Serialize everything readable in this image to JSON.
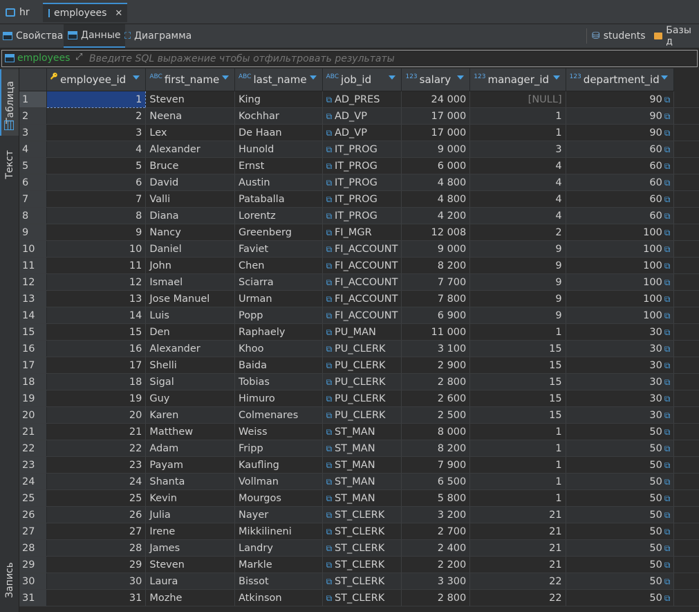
{
  "tabs": [
    {
      "label": "hr",
      "icon": "database-icon"
    },
    {
      "label": "employees",
      "icon": "table-icon",
      "close": "✕"
    }
  ],
  "toolbar": {
    "properties": "Свойства",
    "data": "Данные",
    "diagram": "Диаграмма",
    "students": "students",
    "databases": "Базы д"
  },
  "filter": {
    "table_name": "employees",
    "placeholder": "Введите SQL выражение чтобы отфильтровать результаты"
  },
  "side_tabs": {
    "table": "Таблица",
    "text": "Текст",
    "record": "Запись"
  },
  "columns": [
    "employee_id",
    "first_name",
    "last_name",
    "job_id",
    "salary",
    "manager_id",
    "department_id"
  ],
  "column_types": [
    "",
    "ABC",
    "ABC",
    "ABC",
    "123",
    "123",
    "123"
  ],
  "rows": [
    [
      "1",
      "1",
      "Steven",
      "King",
      "AD_PRES",
      "24 000",
      "[NULL]",
      "90"
    ],
    [
      "2",
      "2",
      "Neena",
      "Kochhar",
      "AD_VP",
      "17 000",
      "1",
      "90"
    ],
    [
      "3",
      "3",
      "Lex",
      "De Haan",
      "AD_VP",
      "17 000",
      "1",
      "90"
    ],
    [
      "4",
      "4",
      "Alexander",
      "Hunold",
      "IT_PROG",
      "9 000",
      "3",
      "60"
    ],
    [
      "5",
      "5",
      "Bruce",
      "Ernst",
      "IT_PROG",
      "6 000",
      "4",
      "60"
    ],
    [
      "6",
      "6",
      "David",
      "Austin",
      "IT_PROG",
      "4 800",
      "4",
      "60"
    ],
    [
      "7",
      "7",
      "Valli",
      "Pataballa",
      "IT_PROG",
      "4 800",
      "4",
      "60"
    ],
    [
      "8",
      "8",
      "Diana",
      "Lorentz",
      "IT_PROG",
      "4 200",
      "4",
      "60"
    ],
    [
      "9",
      "9",
      "Nancy",
      "Greenberg",
      "FI_MGR",
      "12 008",
      "2",
      "100"
    ],
    [
      "10",
      "10",
      "Daniel",
      "Faviet",
      "FI_ACCOUNT",
      "9 000",
      "9",
      "100"
    ],
    [
      "11",
      "11",
      "John",
      "Chen",
      "FI_ACCOUNT",
      "8 200",
      "9",
      "100"
    ],
    [
      "12",
      "12",
      "Ismael",
      "Sciarra",
      "FI_ACCOUNT",
      "7 700",
      "9",
      "100"
    ],
    [
      "13",
      "13",
      "Jose Manuel",
      "Urman",
      "FI_ACCOUNT",
      "7 800",
      "9",
      "100"
    ],
    [
      "14",
      "14",
      "Luis",
      "Popp",
      "FI_ACCOUNT",
      "6 900",
      "9",
      "100"
    ],
    [
      "15",
      "15",
      "Den",
      "Raphaely",
      "PU_MAN",
      "11 000",
      "1",
      "30"
    ],
    [
      "16",
      "16",
      "Alexander",
      "Khoo",
      "PU_CLERK",
      "3 100",
      "15",
      "30"
    ],
    [
      "17",
      "17",
      "Shelli",
      "Baida",
      "PU_CLERK",
      "2 900",
      "15",
      "30"
    ],
    [
      "18",
      "18",
      "Sigal",
      "Tobias",
      "PU_CLERK",
      "2 800",
      "15",
      "30"
    ],
    [
      "19",
      "19",
      "Guy",
      "Himuro",
      "PU_CLERK",
      "2 600",
      "15",
      "30"
    ],
    [
      "20",
      "20",
      "Karen",
      "Colmenares",
      "PU_CLERK",
      "2 500",
      "15",
      "30"
    ],
    [
      "21",
      "21",
      "Matthew",
      "Weiss",
      "ST_MAN",
      "8 000",
      "1",
      "50"
    ],
    [
      "22",
      "22",
      "Adam",
      "Fripp",
      "ST_MAN",
      "8 200",
      "1",
      "50"
    ],
    [
      "23",
      "23",
      "Payam",
      "Kaufling",
      "ST_MAN",
      "7 900",
      "1",
      "50"
    ],
    [
      "24",
      "24",
      "Shanta",
      "Vollman",
      "ST_MAN",
      "6 500",
      "1",
      "50"
    ],
    [
      "25",
      "25",
      "Kevin",
      "Mourgos",
      "ST_MAN",
      "5 800",
      "1",
      "50"
    ],
    [
      "26",
      "26",
      "Julia",
      "Nayer",
      "ST_CLERK",
      "3 200",
      "21",
      "50"
    ],
    [
      "27",
      "27",
      "Irene",
      "Mikkilineni",
      "ST_CLERK",
      "2 700",
      "21",
      "50"
    ],
    [
      "28",
      "28",
      "James",
      "Landry",
      "ST_CLERK",
      "2 400",
      "21",
      "50"
    ],
    [
      "29",
      "29",
      "Steven",
      "Markle",
      "ST_CLERK",
      "2 200",
      "21",
      "50"
    ],
    [
      "30",
      "30",
      "Laura",
      "Bissot",
      "ST_CLERK",
      "3 300",
      "22",
      "50"
    ],
    [
      "31",
      "31",
      "Mozhe",
      "Atkinson",
      "ST_CLERK",
      "2 800",
      "22",
      "50"
    ]
  ],
  "colors": {
    "background": "#2b2b2b",
    "accent": "#4aa0e0",
    "selection": "#214283",
    "filter_table": "#3aa84a"
  }
}
